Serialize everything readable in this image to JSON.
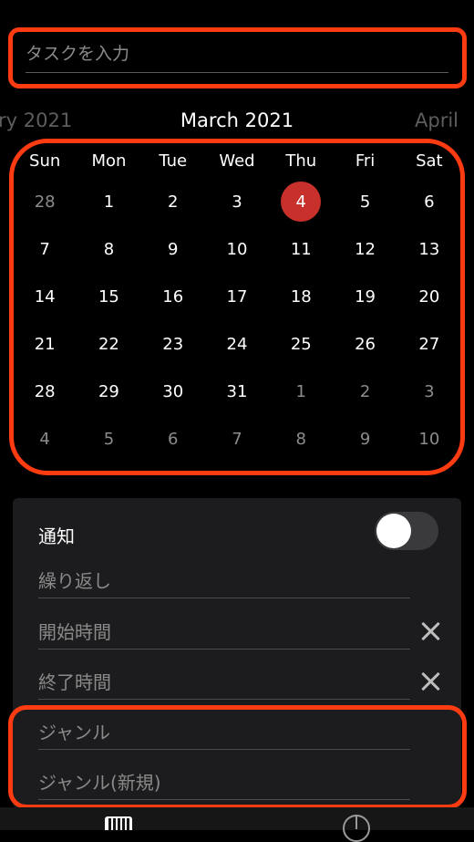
{
  "task": {
    "placeholder": "タスクを入力"
  },
  "calendar": {
    "prev_month": "ry 2021",
    "current_month": "March 2021",
    "next_month": "April",
    "weekdays": [
      "Sun",
      "Mon",
      "Tue",
      "Wed",
      "Thu",
      "Fri",
      "Sat"
    ],
    "weeks": [
      [
        "28",
        "1",
        "2",
        "3",
        "4",
        "5",
        "6"
      ],
      [
        "7",
        "8",
        "9",
        "10",
        "11",
        "12",
        "13"
      ],
      [
        "14",
        "15",
        "16",
        "17",
        "18",
        "19",
        "20"
      ],
      [
        "21",
        "22",
        "23",
        "24",
        "25",
        "26",
        "27"
      ],
      [
        "28",
        "29",
        "30",
        "31",
        "1",
        "2",
        "3"
      ],
      [
        "4",
        "5",
        "6",
        "7",
        "8",
        "9",
        "10"
      ]
    ],
    "selected_day": "4",
    "selected_color": "#c8302c"
  },
  "settings": {
    "notification_label": "通知",
    "notification_on": false,
    "repeat_placeholder": "繰り返し",
    "start_time_placeholder": "開始時間",
    "end_time_placeholder": "終了時間",
    "genre_placeholder": "ジャンル",
    "new_genre_placeholder": "ジャンル(新規)"
  },
  "tabbar": {
    "items": [
      "calendar-icon",
      "pie-chart-icon"
    ]
  },
  "highlight_color": "#ff3b12"
}
